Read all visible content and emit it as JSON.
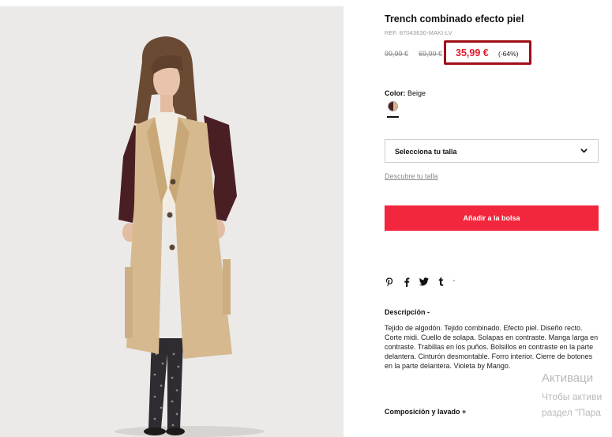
{
  "product": {
    "title": "Trench combinado efecto piel",
    "ref": "REF. 87043630-MAKI-LV",
    "old_price_1": "99,99 €",
    "old_price_2": "69,99 €",
    "price": "35,99 €",
    "discount": "(-64%)",
    "image_alt": "Model wearing beige trench coat with burgundy faux-leather sleeves"
  },
  "color": {
    "label": "Color:",
    "value": "Beige",
    "swatch_colors": [
      "#4a1f24",
      "#d8b68b"
    ]
  },
  "size": {
    "select_label": "Selecciona tu talla",
    "discover_link": "Descubre tu talla"
  },
  "cart": {
    "add_label": "Añadir a la bolsa",
    "button_color": "#f2263c"
  },
  "share": {
    "icons": [
      "pinterest-icon",
      "facebook-icon",
      "twitter-icon",
      "tumblr-icon"
    ],
    "glyphs": [
      "𝗽",
      "f",
      "🐦",
      "t"
    ]
  },
  "description": {
    "heading": "Descripción",
    "heading_suffix": "-",
    "text": "Tejido de algodón. Tejido combinado. Efecto piel. Diseño recto. Corte midi. Cuello de solapa. Solapas en contraste. Manga larga en contraste. Trabillas en los puños. Bolsillos en contraste en la parte delantera. Cinturón desmontable. Forro interior. Cierre de botones en la parte delantera. Violeta by Mango."
  },
  "composition": {
    "heading": "Composición y lavado",
    "toggle": "+"
  },
  "watermark": {
    "line1": "Активаци",
    "line2": "Чтобы активи",
    "line3": "раздел \"Пара"
  },
  "colors": {
    "sale_price": "#e01a2b",
    "highlight_border": "#9e0e17",
    "photo_background": "#ebeae8"
  }
}
